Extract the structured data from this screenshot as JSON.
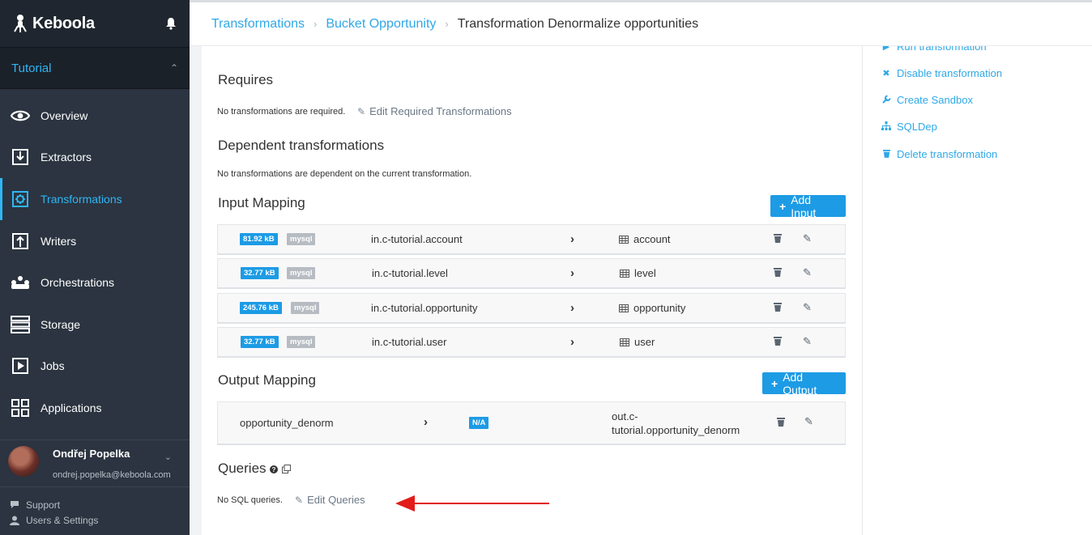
{
  "brand": {
    "name": "Keboola"
  },
  "project": {
    "name": "Tutorial"
  },
  "nav": [
    {
      "label": "Overview",
      "icon": "eye-icon"
    },
    {
      "label": "Extractors",
      "icon": "download-icon"
    },
    {
      "label": "Transformations",
      "icon": "gear-icon",
      "active": true
    },
    {
      "label": "Writers",
      "icon": "upload-icon"
    },
    {
      "label": "Orchestrations",
      "icon": "orchestration-icon"
    },
    {
      "label": "Storage",
      "icon": "storage-icon"
    },
    {
      "label": "Jobs",
      "icon": "play-icon"
    },
    {
      "label": "Applications",
      "icon": "grid-icon"
    }
  ],
  "user": {
    "name": "Ondřej Popelka",
    "email": "ondrej.popelka@keboola.com"
  },
  "footer": {
    "support": "Support",
    "settings": "Users & Settings"
  },
  "breadcrumb": {
    "items": [
      "Transformations",
      "Bucket Opportunity"
    ],
    "current": "Transformation Denormalize opportunities"
  },
  "requires": {
    "title": "Requires",
    "text": "No transformations are required.",
    "edit_label": "Edit Required Transformations"
  },
  "dependent": {
    "title": "Dependent transformations",
    "text": "No transformations are dependent on the current transformation."
  },
  "input_mapping": {
    "title": "Input Mapping",
    "add_label": "Add Input",
    "rows": [
      {
        "size": "81.92 kB",
        "type": "mysql",
        "source": "in.c-tutorial.account",
        "dest": "account"
      },
      {
        "size": "32.77 kB",
        "type": "mysql",
        "source": "in.c-tutorial.level",
        "dest": "level"
      },
      {
        "size": "245.76 kB",
        "type": "mysql",
        "source": "in.c-tutorial.opportunity",
        "dest": "opportunity"
      },
      {
        "size": "32.77 kB",
        "type": "mysql",
        "source": "in.c-tutorial.user",
        "dest": "user"
      }
    ]
  },
  "output_mapping": {
    "title": "Output Mapping",
    "add_label": "Add Output",
    "rows": [
      {
        "source": "opportunity_denorm",
        "badge": "N/A",
        "dest_line1": "out.c-",
        "dest_line2": "tutorial.opportunity_denorm"
      }
    ]
  },
  "queries": {
    "title": "Queries",
    "text": "No SQL queries.",
    "edit_label": "Edit Queries"
  },
  "actions": [
    {
      "label": "Run transformation",
      "icon": "play-icon"
    },
    {
      "label": "Disable transformation",
      "icon": "close-icon"
    },
    {
      "label": "Create Sandbox",
      "icon": "wrench-icon"
    },
    {
      "label": "SQLDep",
      "icon": "sitemap-icon"
    },
    {
      "label": "Delete transformation",
      "icon": "trash-icon"
    }
  ],
  "colors": {
    "accent": "#1d9be5",
    "sidebar": "#2b3440",
    "link": "#2fa8e6",
    "annotation_arrow": "#e31b1b"
  }
}
